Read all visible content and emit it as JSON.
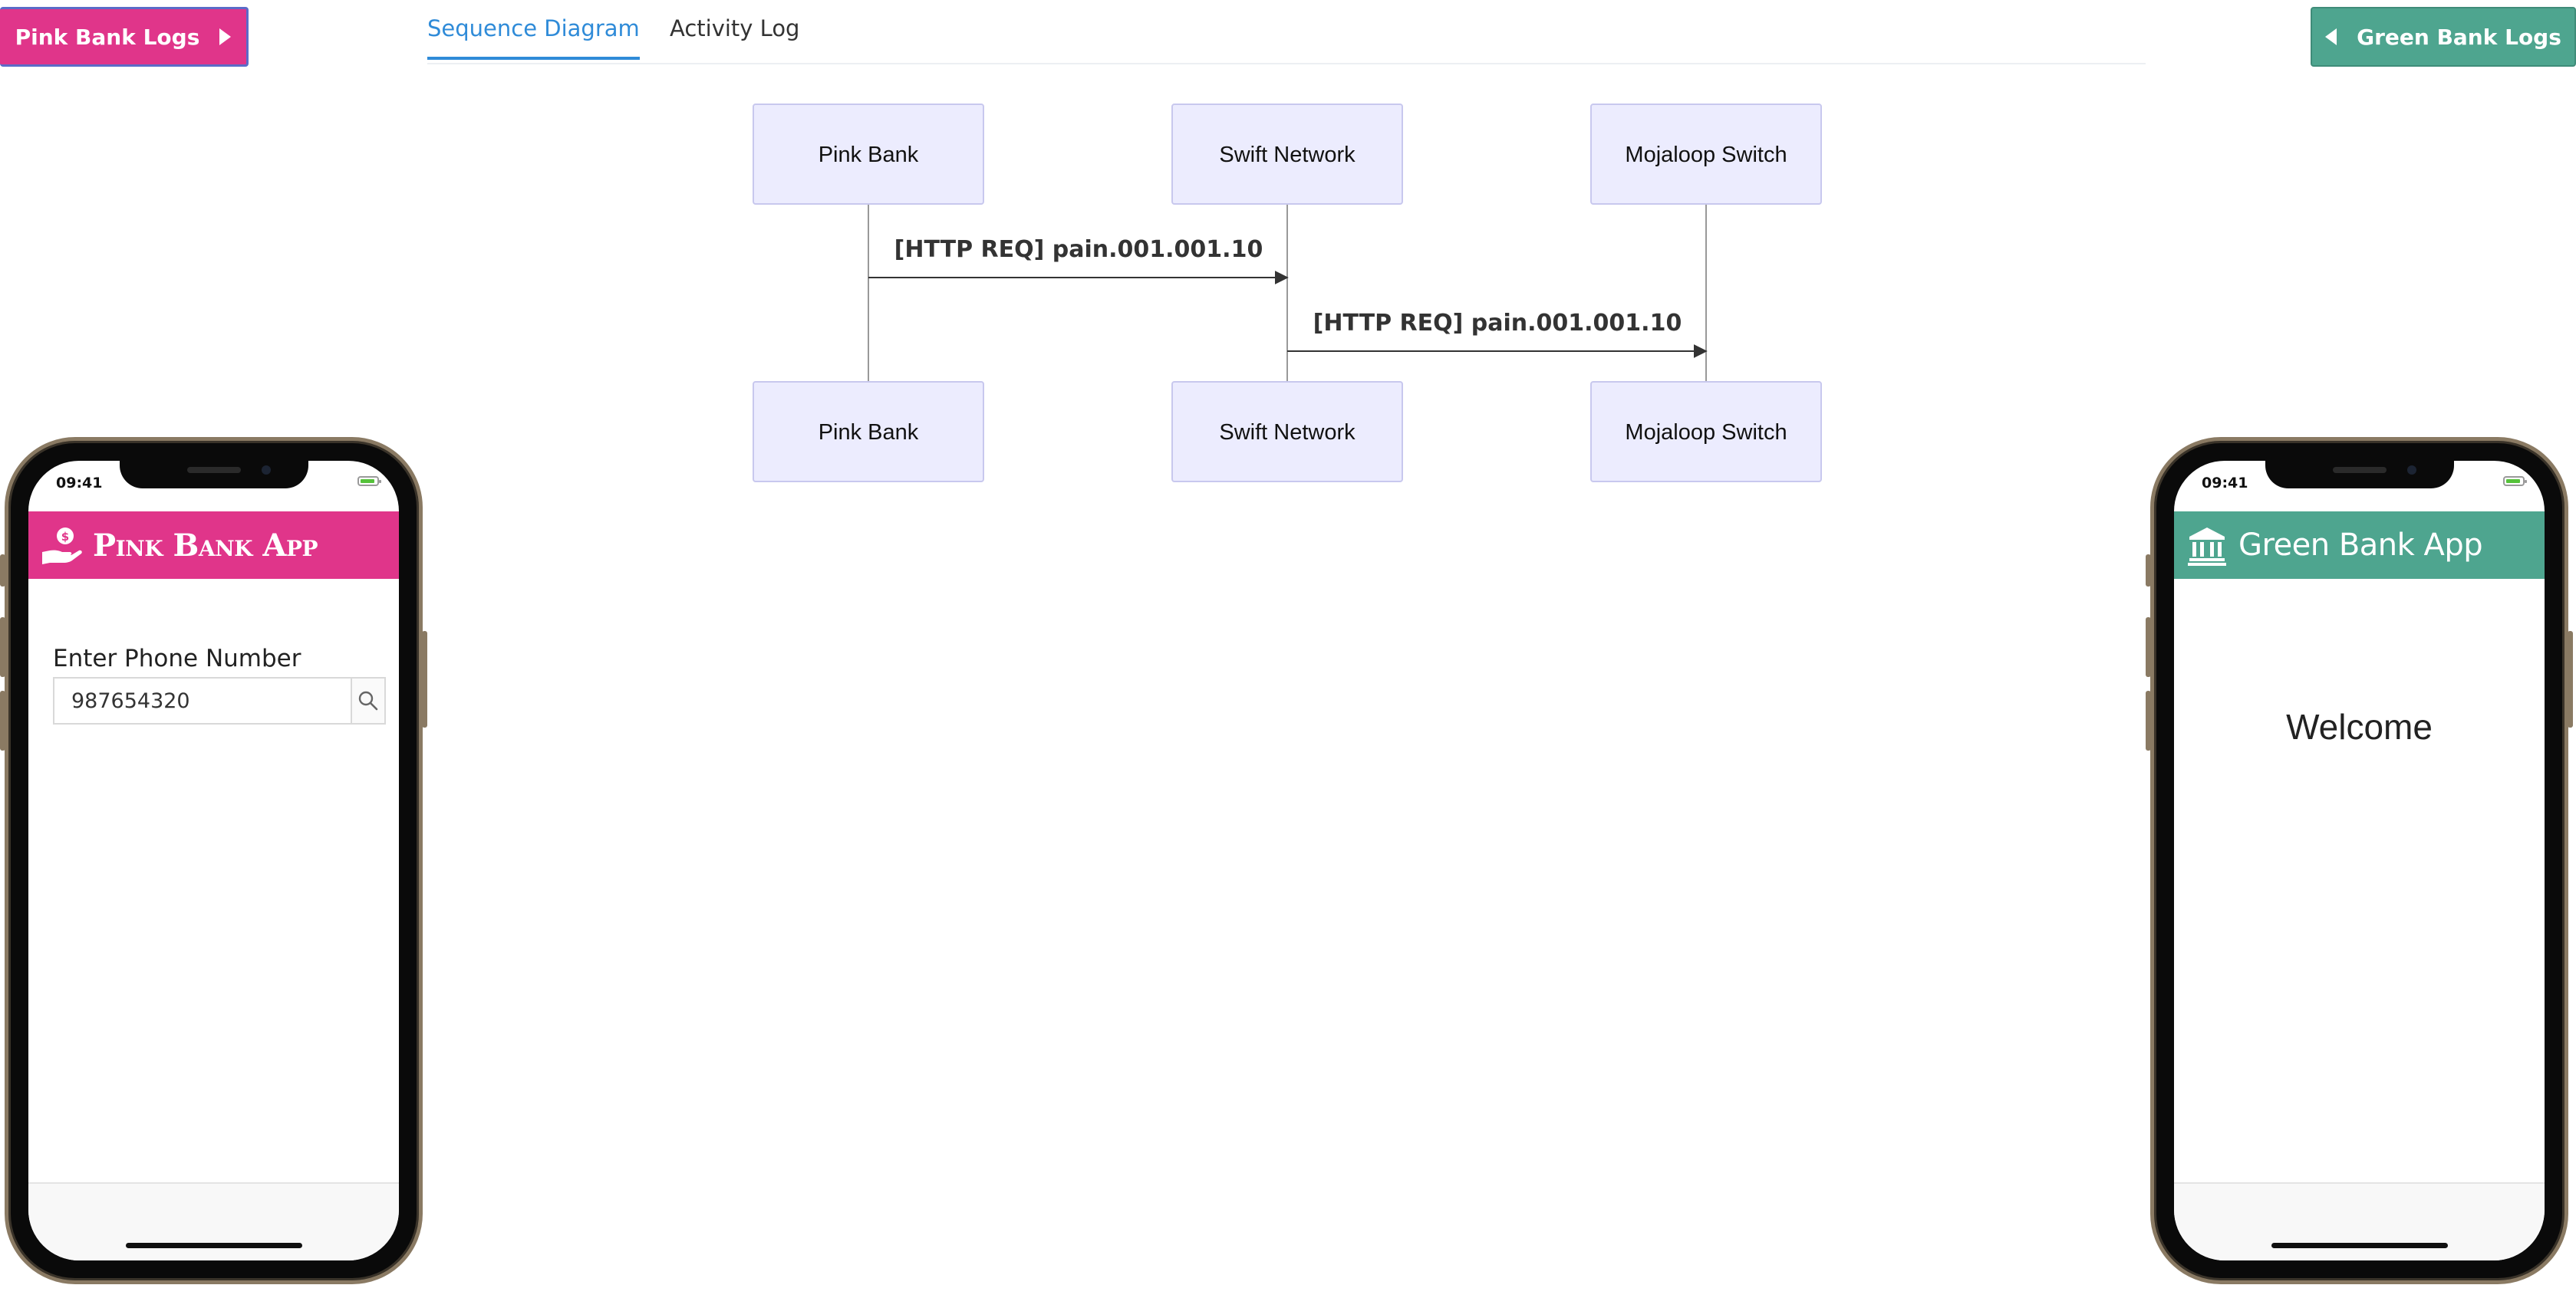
{
  "buttons": {
    "pink_logs": "Pink Bank Logs",
    "green_logs": "Green Bank Logs"
  },
  "tabs": [
    {
      "label": "Sequence Diagram",
      "active": true
    },
    {
      "label": "Activity Log",
      "active": false
    }
  ],
  "sequence": {
    "participants": [
      "Pink Bank",
      "Swift Network",
      "Mojaloop Switch"
    ],
    "messages": [
      {
        "from": "Pink Bank",
        "to": "Swift Network",
        "label": "[HTTP REQ] pain.001.001.10"
      },
      {
        "from": "Swift Network",
        "to": "Mojaloop Switch",
        "label": "[HTTP REQ] pain.001.001.10"
      }
    ]
  },
  "pink_phone": {
    "time": "09:41",
    "app_title": "Pink Bank App",
    "icon": "hand-coin-icon",
    "input_label": "Enter Phone Number",
    "input_value": "987654320",
    "search_icon": "search-icon"
  },
  "green_phone": {
    "time": "09:41",
    "app_title": "Green Bank App",
    "icon": "bank-icon",
    "welcome": "Welcome"
  },
  "colors": {
    "pink": "#e0358a",
    "green": "#4ea58f",
    "tab_active": "#2f8bd8",
    "actor_fill": "#ececfe",
    "actor_stroke": "#c8c8ee"
  }
}
